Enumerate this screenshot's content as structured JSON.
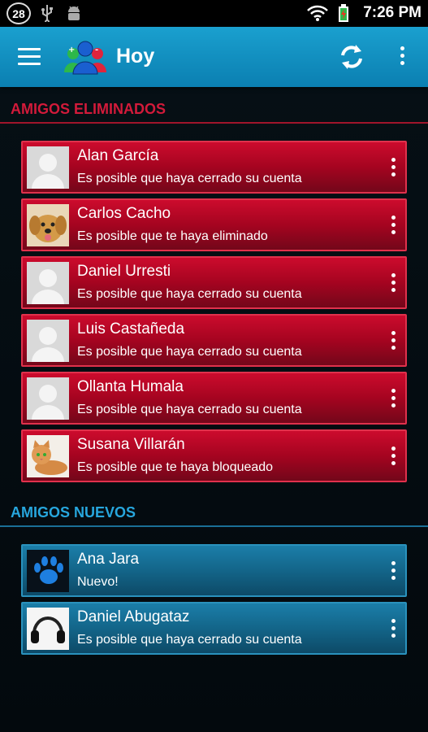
{
  "status_bar": {
    "notification_count": "28",
    "icons": [
      "usb-icon",
      "android-debug-icon",
      "wifi-icon",
      "battery-icon"
    ],
    "time": "7:26 PM"
  },
  "app_bar": {
    "title": "Hoy",
    "actions": [
      "menu-icon",
      "refresh-icon",
      "overflow-menu-icon"
    ]
  },
  "sections": {
    "removed": {
      "title": "AMIGOS ELIMINADOS",
      "color": "#d21a3a",
      "items": [
        {
          "name": "Alan García",
          "status": "Es posible que haya cerrado su cuenta",
          "avatar": "default-avatar"
        },
        {
          "name": "Carlos Cacho",
          "status": "Es posible que te haya eliminado",
          "avatar": "puppy-photo"
        },
        {
          "name": "Daniel Urresti",
          "status": "Es posible que haya cerrado su cuenta",
          "avatar": "default-avatar"
        },
        {
          "name": "Luis Castañeda",
          "status": "Es posible que haya cerrado su cuenta",
          "avatar": "default-avatar"
        },
        {
          "name": "Ollanta Humala",
          "status": "Es posible que haya cerrado su cuenta",
          "avatar": "default-avatar"
        },
        {
          "name": "Susana Villarán",
          "status": "Es posible que te haya bloqueado",
          "avatar": "cat-photo"
        }
      ]
    },
    "new": {
      "title": "AMIGOS NUEVOS",
      "color": "#27a6dd",
      "items": [
        {
          "name": "Ana Jara",
          "status": "Nuevo!",
          "avatar": "paw-photo"
        },
        {
          "name": "Daniel Abugataz",
          "status": "Es posible que haya cerrado su cuenta",
          "avatar": "headphones-photo"
        }
      ]
    }
  }
}
